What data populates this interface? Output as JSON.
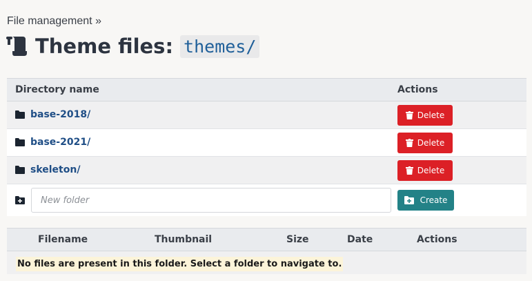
{
  "breadcrumb": {
    "parent": "File management",
    "sep": " »"
  },
  "header": {
    "title": "Theme files:",
    "path": "themes/",
    "icon": "scroll-icon"
  },
  "directories": {
    "columns": {
      "name": "Directory name",
      "actions": "Actions"
    },
    "rows": [
      {
        "name": "base-2018/",
        "action": "Delete"
      },
      {
        "name": "base-2021/",
        "action": "Delete"
      },
      {
        "name": "skeleton/",
        "action": "Delete"
      }
    ],
    "new_folder": {
      "placeholder": "New folder",
      "value": "",
      "button": "Create"
    }
  },
  "files": {
    "columns": {
      "filename": "Filename",
      "thumbnail": "Thumbnail",
      "size": "Size",
      "date": "Date",
      "actions": "Actions"
    },
    "empty_message": "No files are present in this folder. Select a folder to navigate to."
  },
  "colors": {
    "delete": "#dc2026",
    "create": "#238287",
    "link": "#1f4e86",
    "notice_bg": "#fcf4d9"
  }
}
